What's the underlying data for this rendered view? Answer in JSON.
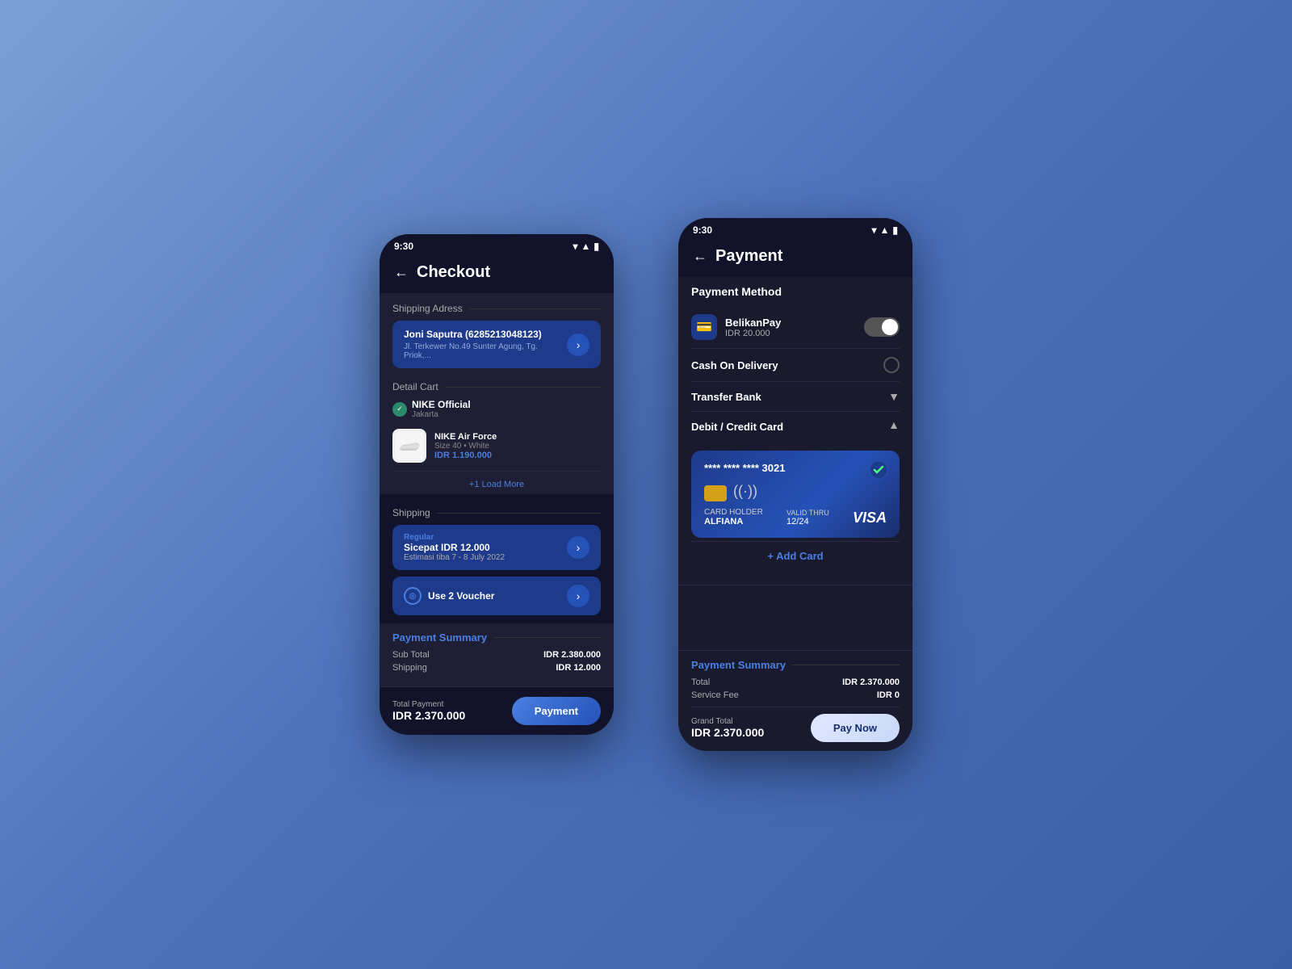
{
  "background": {
    "gradient_start": "#7b9fd4",
    "gradient_end": "#3a5fa8"
  },
  "checkout_phone": {
    "status_bar": {
      "time": "9:30"
    },
    "header": {
      "back_icon": "←",
      "title": "Checkout"
    },
    "shipping_address": {
      "section_label": "Shipping Adress",
      "name": "Joni Saputra (6285213048123)",
      "address": "Jl. Terkewer No.49 Sunter Agung, Tg. Priok,..."
    },
    "detail_cart": {
      "section_label": "Detail Cart",
      "store_name": "NIKE Official",
      "store_location": "Jakarta",
      "item_name": "NIKE Air Force",
      "item_spec": "Size 40  •  White",
      "item_price": "IDR 1.190.000",
      "load_more": "+1 Load More"
    },
    "shipping": {
      "section_label": "Shipping",
      "type": "Regular",
      "name": "Sicepat IDR 12.000",
      "eta": "Estimasi tiba  7 - 8 July 2022",
      "voucher": "Use 2 Voucher"
    },
    "payment_summary": {
      "title": "Payment Summary",
      "sub_total_label": "Sub Total",
      "sub_total_value": "IDR 2.380.000",
      "shipping_label": "Shipping",
      "shipping_value": "IDR 12.000"
    },
    "bottom_bar": {
      "total_label": "Total Payment",
      "total_amount": "IDR 2.370.000",
      "pay_button": "Payment"
    }
  },
  "payment_phone": {
    "status_bar": {
      "time": "9:30"
    },
    "header": {
      "back_icon": "←",
      "title": "Payment"
    },
    "payment_method": {
      "title": "Payment Method",
      "belikanpay": {
        "icon": "💳",
        "name": "BelikanPay",
        "balance": "IDR 20.000"
      },
      "cash_on_delivery": {
        "name": "Cash On Delivery"
      },
      "transfer_bank": {
        "name": "Transfer Bank"
      },
      "debit_credit": {
        "name": "Debit / Credit Card"
      }
    },
    "credit_card": {
      "number": "**** **** **** 3021",
      "chip_color": "#d4a017",
      "holder_label": "ALFIANA",
      "valid_label": "VALID THRU",
      "valid_date": "12/24",
      "brand": "VISA"
    },
    "add_card": "+ Add Card",
    "payment_summary": {
      "title": "Payment Summary",
      "total_label": "Total",
      "total_value": "IDR 2.370.000",
      "service_fee_label": "Service Fee",
      "service_fee_value": "IDR 0"
    },
    "bottom_bar": {
      "grand_total_label": "Grand Total",
      "grand_total_amount": "IDR 2.370.000",
      "pay_button": "Pay Now"
    }
  }
}
